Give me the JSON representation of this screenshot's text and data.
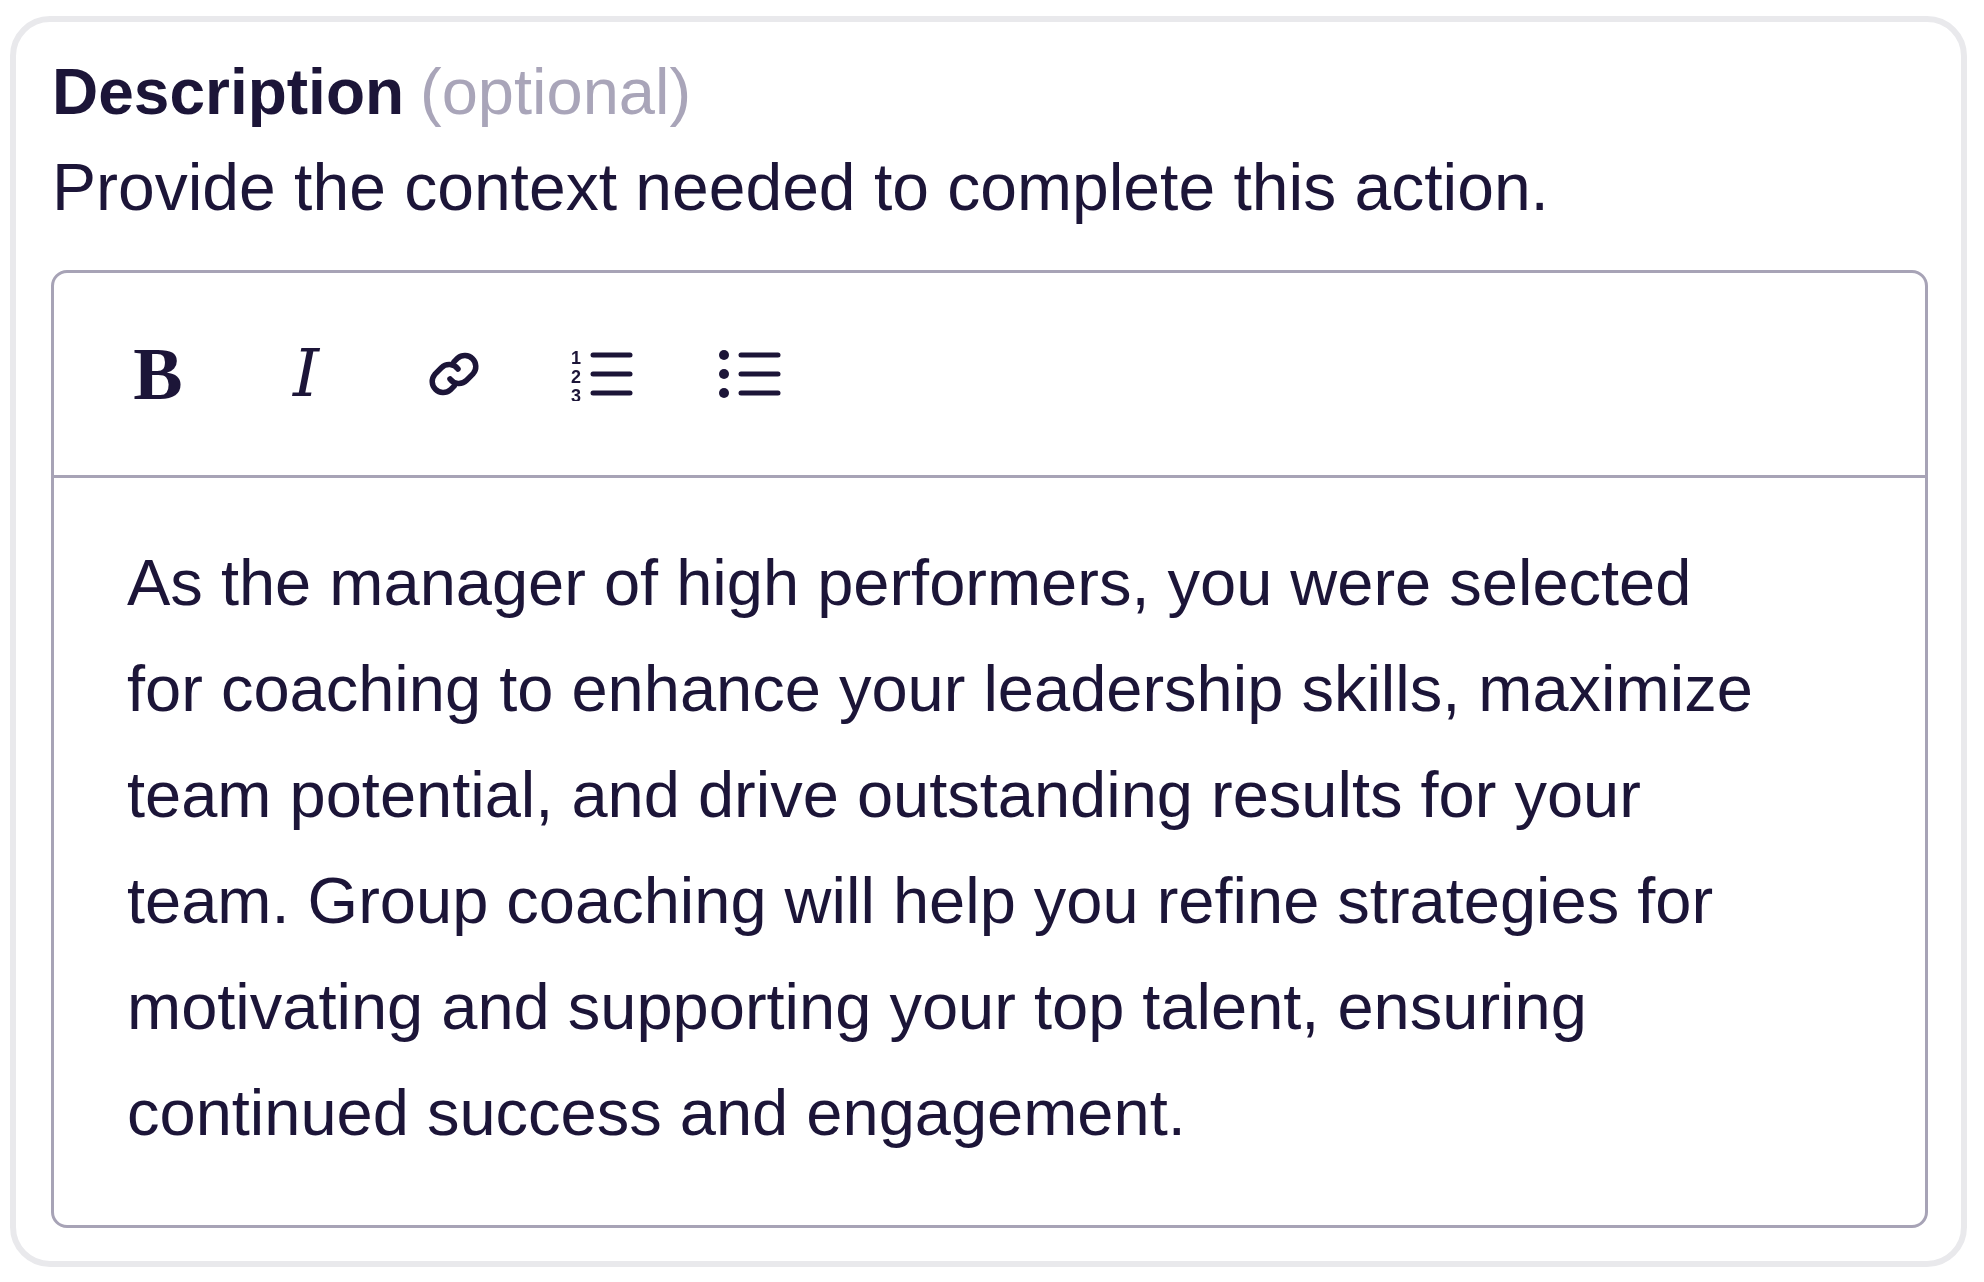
{
  "field": {
    "label": "Description",
    "optional_note": "(optional)",
    "help_text": "Provide the context needed to complete this action."
  },
  "editor": {
    "toolbar": [
      {
        "kind": "bold",
        "label": "B"
      },
      {
        "kind": "italic",
        "label": "I"
      },
      {
        "kind": "link"
      },
      {
        "kind": "ordered_list",
        "numbers": [
          "1",
          "2",
          "3"
        ]
      },
      {
        "kind": "bullet_list"
      }
    ],
    "value": "As the manager of high performers, you were selected for coaching to enhance your leadership skills, maximize team potential, and drive outstanding results for your team. Group coaching will help you refine strategies for motivating and supporting your top talent, ensuring continued success and engagement."
  }
}
